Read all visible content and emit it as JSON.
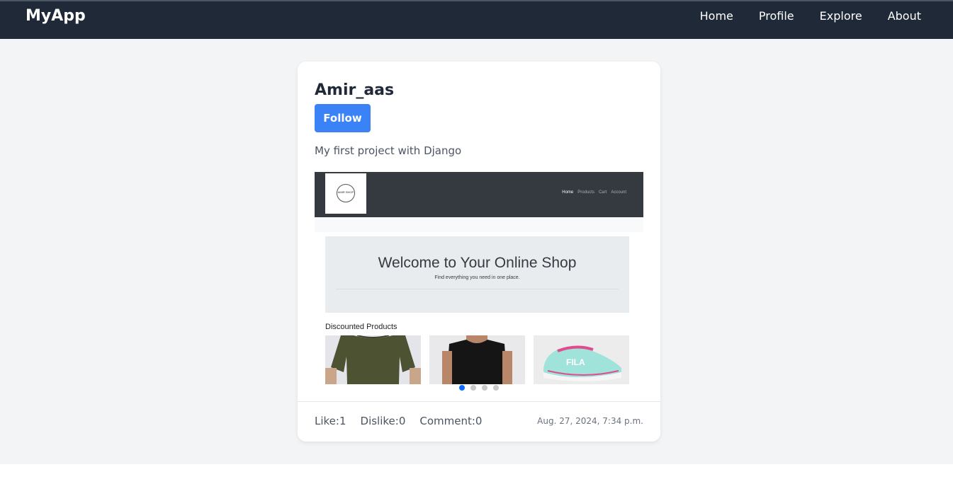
{
  "navbar": {
    "brand": "MyApp",
    "links": [
      "Home",
      "Profile",
      "Explore",
      "About"
    ]
  },
  "post": {
    "username": "Amir_aas",
    "follow_label": "Follow",
    "description": "My first project with Django",
    "preview": {
      "logo_text": "AMIR SHOP",
      "nav_links": [
        "Home",
        "Products",
        "Cart",
        "Account"
      ],
      "hero_title": "Welcome to Your Online Shop",
      "hero_subtitle": "Find everything you need in one place.",
      "section_title": "Discounted Products",
      "products": [
        "olive-shirt-image",
        "black-tshirt-image",
        "mint-sneaker-image"
      ],
      "carousel_active_index": 0,
      "carousel_count": 4
    },
    "stats": {
      "like": "Like:1",
      "dislike": "Dislike:0",
      "comment": "Comment:0"
    },
    "timestamp": "Aug. 27, 2024, 7:34 p.m."
  },
  "colors": {
    "navbar": "#1f2937",
    "accent": "#3b82f6",
    "page_bg": "#f3f4f6",
    "shop_nav": "#343a40"
  }
}
